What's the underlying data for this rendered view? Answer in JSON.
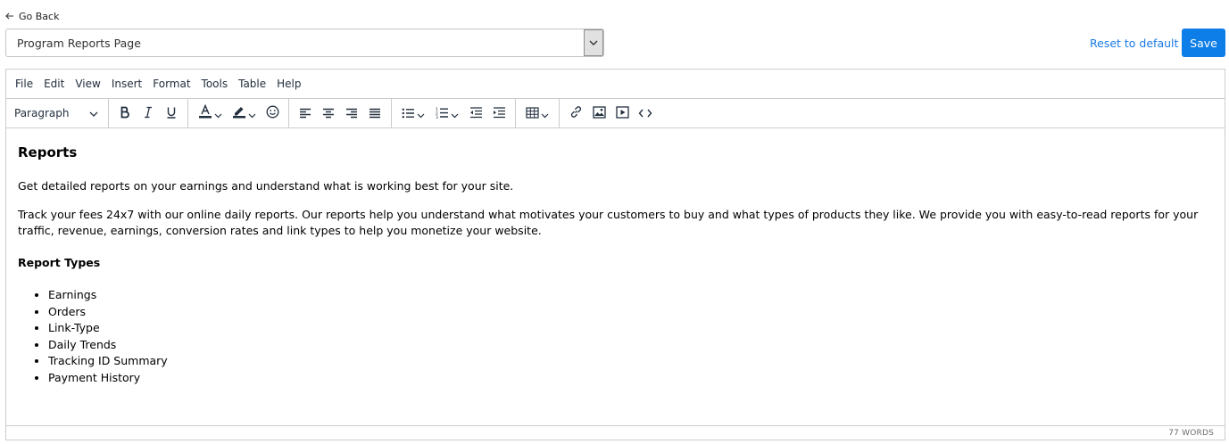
{
  "nav": {
    "go_back": "Go Back"
  },
  "page_select": {
    "value": "Program Reports Page"
  },
  "actions": {
    "reset": "Reset to default",
    "save": "Save"
  },
  "colors": {
    "accent": "#0d7ee8",
    "link": "#1a7ae3",
    "border": "#cccccc"
  },
  "editor": {
    "menu": [
      "File",
      "Edit",
      "View",
      "Insert",
      "Format",
      "Tools",
      "Table",
      "Help"
    ],
    "toolbar": {
      "block_format": "Paragraph",
      "icons": [
        "bold-icon",
        "italic-icon",
        "underline-icon",
        "text-color-icon",
        "highlight-color-icon",
        "emoji-icon",
        "align-left-icon",
        "align-center-icon",
        "align-right-icon",
        "align-justify-icon",
        "bullet-list-icon",
        "numbered-list-icon",
        "outdent-icon",
        "indent-icon",
        "table-icon",
        "link-icon",
        "image-icon",
        "media-icon",
        "source-code-icon"
      ]
    },
    "content": {
      "heading": "Reports",
      "intro": "Get detailed reports on your earnings and understand what is working best for your site.",
      "body": "Track your fees 24x7 with our online daily reports. Our reports help you understand what motivates your customers to buy and what types of products they like. We provide you with easy-to-read reports for your traffic, revenue, earnings, conversion rates and link types to help you monetize your website.",
      "subheading": "Report Types",
      "items": [
        "Earnings",
        "Orders",
        "Link-Type",
        "Daily Trends",
        "Tracking ID Summary",
        "Payment History"
      ]
    },
    "status": {
      "word_count": "77 WORDS"
    }
  }
}
